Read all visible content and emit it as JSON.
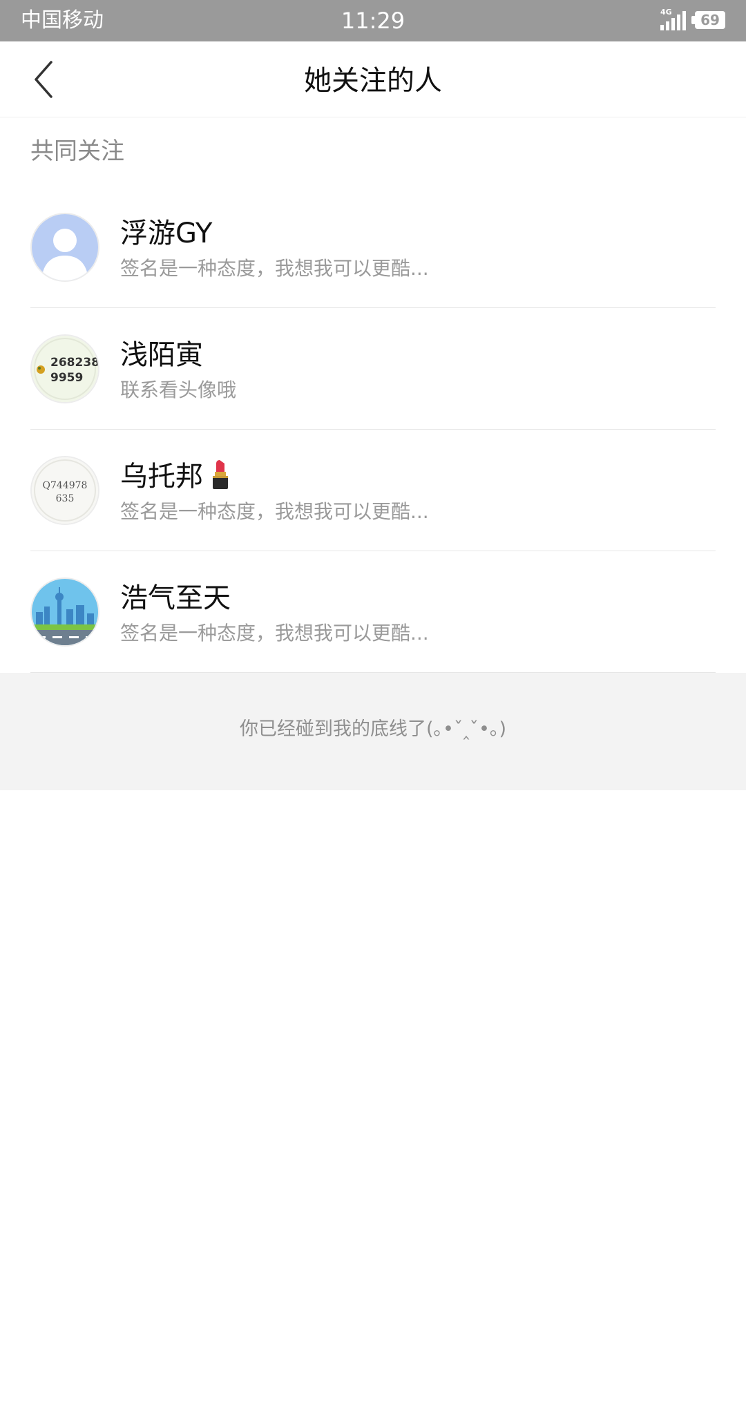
{
  "status_bar": {
    "carrier": "中国移动",
    "time": "11:29",
    "network": "4G",
    "battery": "69"
  },
  "nav": {
    "title": "她关注的人"
  },
  "section": {
    "header": "共同关注"
  },
  "users": [
    {
      "name": "浮游GY",
      "signature": "签名是一种态度，我想我可以更酷...",
      "avatar_icon": "default-avatar-icon"
    },
    {
      "name": "浅陌寅",
      "signature": "联系看头像哦",
      "avatar_icon": "qq-number-avatar-icon",
      "avatar_text_line1": "268238",
      "avatar_text_line2": "9959"
    },
    {
      "name": "乌托邦",
      "signature": "签名是一种态度，我想我可以更酷...",
      "avatar_icon": "qq-number-avatar-icon",
      "avatar_text_line1": "Q744978",
      "avatar_text_line2": "635",
      "name_emoji_icon": "lipstick-icon"
    },
    {
      "name": "浩气至天",
      "signature": "签名是一种态度，我想我可以更酷...",
      "avatar_icon": "city-skyline-avatar-icon"
    }
  ],
  "footer": {
    "end_text": "你已经碰到我的底线了(｡•ˇ‸ˇ•｡)"
  },
  "colors": {
    "status_bar_bg": "#9a9a9a",
    "footer_bg": "#f3f3f3",
    "lipstick": "#e0344a"
  }
}
